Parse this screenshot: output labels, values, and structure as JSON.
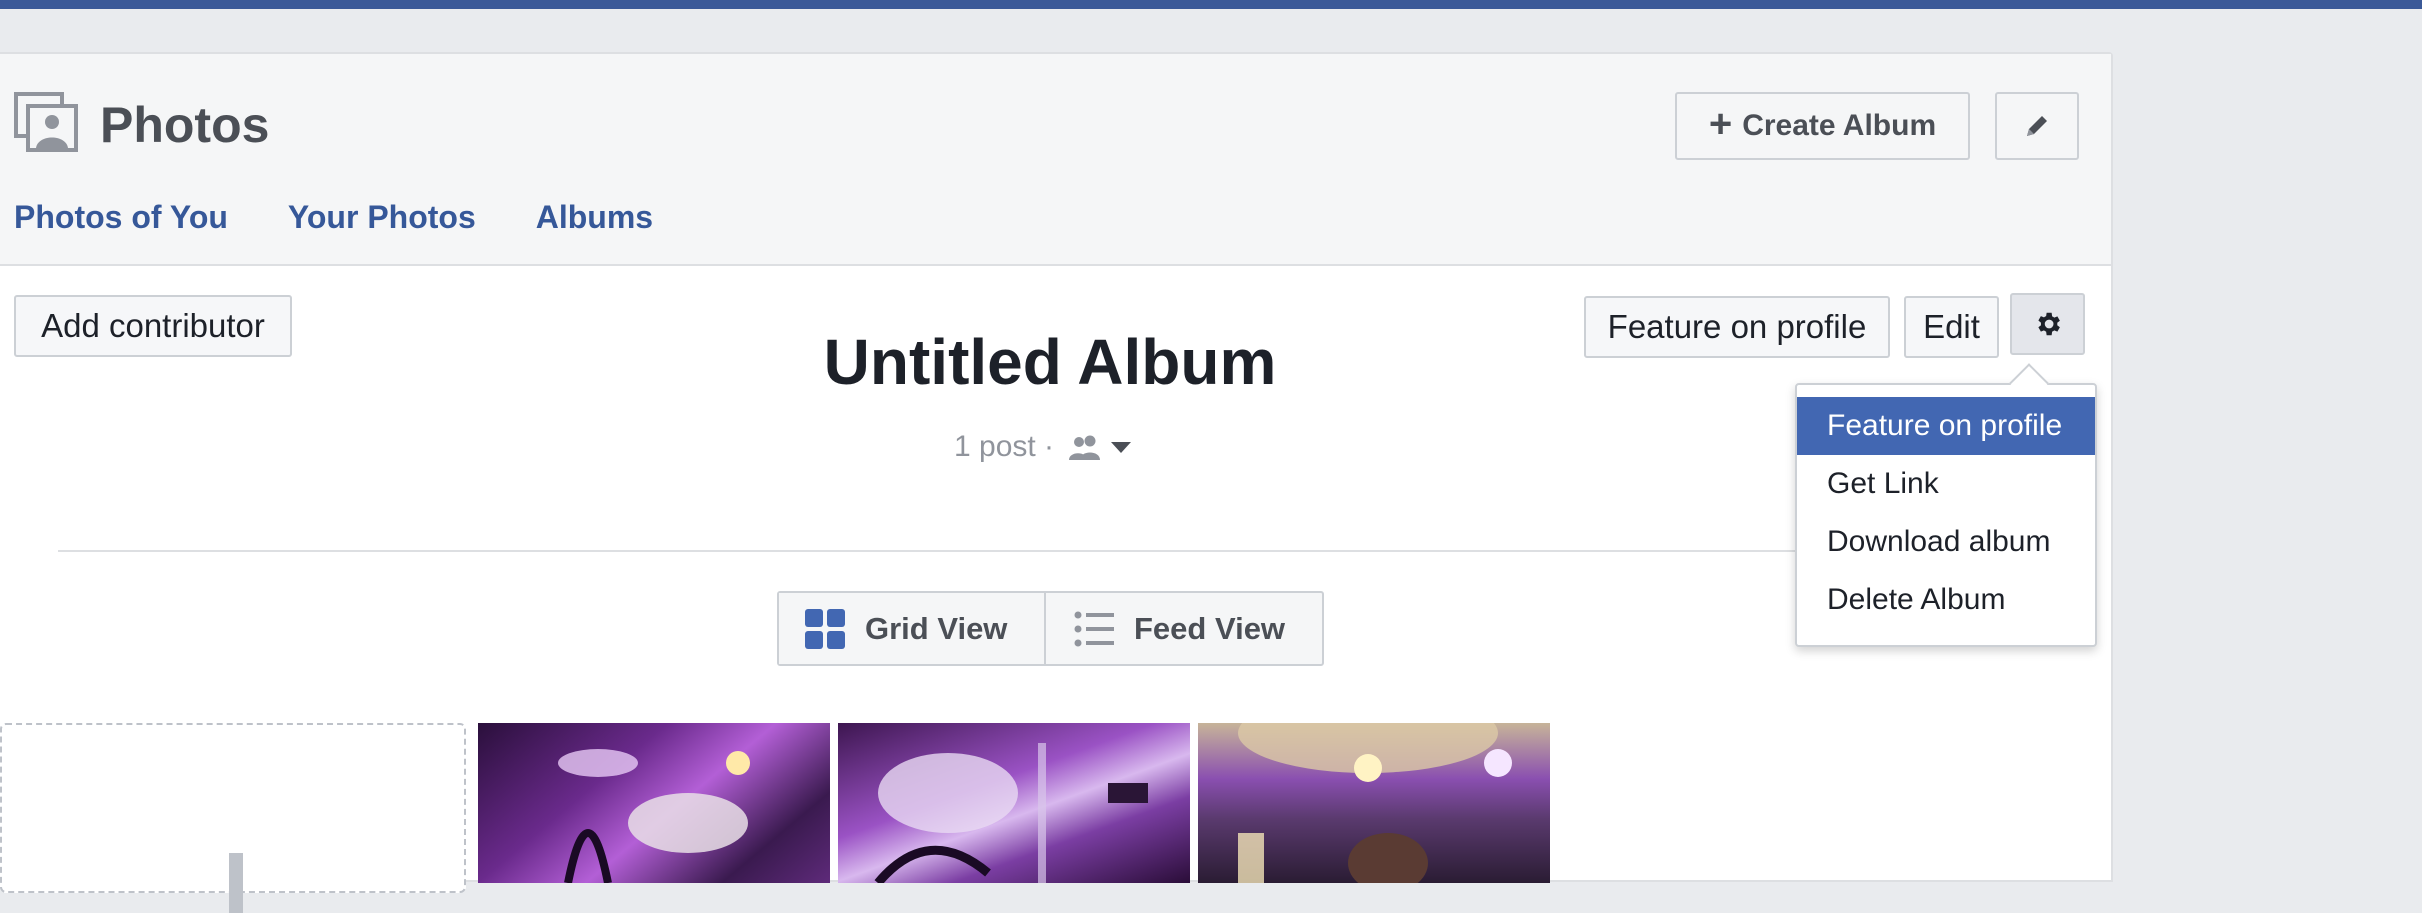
{
  "header": {
    "title": "Photos",
    "create_album_label": "Create Album"
  },
  "tabs": [
    {
      "label": "Photos of You"
    },
    {
      "label": "Your Photos"
    },
    {
      "label": "Albums"
    }
  ],
  "album": {
    "add_contributor_label": "Add contributor",
    "feature_label": "Feature on profile",
    "edit_label": "Edit",
    "title": "Untitled Album",
    "meta": "1 post ·"
  },
  "views": {
    "grid_label": "Grid View",
    "feed_label": "Feed View"
  },
  "menu": {
    "items": [
      {
        "label": "Feature on profile",
        "active": true
      },
      {
        "label": "Get Link"
      },
      {
        "label": "Download album"
      },
      {
        "label": "Delete Album"
      }
    ]
  },
  "colors": {
    "brand": "#3b5998",
    "link": "#365899",
    "highlight": "#4267b2"
  }
}
